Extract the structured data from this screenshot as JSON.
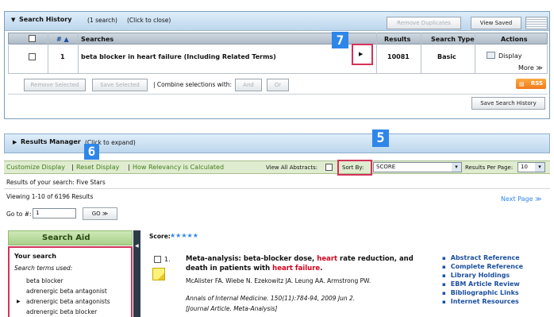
{
  "history": {
    "title": "Search History",
    "count": "(1 search)",
    "toggle": "(Click to close)",
    "remove_duplicates": "Remove Duplicates",
    "view_saved": "View Saved",
    "columns": {
      "num": "# ▲",
      "searches": "Searches",
      "results": "Results",
      "type": "Search Type",
      "actions": "Actions"
    },
    "row": {
      "num": "1",
      "search": "beta blocker in heart failure (Including Related Terms)",
      "results": "10081",
      "type": "Basic",
      "display": "Display",
      "more": "More ≫"
    },
    "remove_selected": "Remove Selected",
    "save_selected": "Save Selected",
    "combine_label": "| Combine selections with:",
    "and": "And",
    "or": "Or",
    "rss": "RSS",
    "save_history": "Save Search History"
  },
  "results_manager": {
    "title": "Results Manager",
    "hint": "(Click to expand)"
  },
  "toolbar": {
    "customize": "Customize Display",
    "reset": "Reset Display",
    "relevancy": "How Relevancy is Calculated",
    "view_abstracts": "View All Abstracts:",
    "sort_by": "Sort By:",
    "sort_value": "SCORE",
    "per_page_label": "Results Per Page:",
    "per_page_value": "10"
  },
  "results": {
    "search_label": "Results of your search: Five Stars",
    "viewing": "Viewing 1-10 of 6196 Results",
    "goto_label": "Go to #:",
    "goto_value": "1",
    "go_button": "GO ≫",
    "next_page": "Next Page ≫"
  },
  "search_aid": {
    "title": "Search Aid",
    "your_search": "Your search",
    "terms_used": "Search terms used:",
    "terms": [
      "beta blocker",
      "adrenergic beta antagonist",
      "adrenergic beta antagonists",
      "adrenergic beta blocker"
    ]
  },
  "record": {
    "score_label": "Score:",
    "stars": "★★★★★",
    "number": "1.",
    "title_a": "Meta-analysis: beta-blocker dose,",
    "title_hl1": "heart",
    "title_b": "rate reduction, and death in patients with",
    "title_hl2": "heart failure",
    "title_end": ".",
    "authors": "McAlister FA. Wiebe N. Ezekowitz JA. Leung AA. Armstrong PW.",
    "citation": "Annals of Internal Medicine. 150(11):784-94, 2009 Jun 2.",
    "pubtype": "[Journal Article. Meta-Analysis]",
    "links": [
      "Abstract Reference",
      "Complete Reference",
      "Library Holdings",
      "EBM Article Review",
      "Bibliographic Links",
      "Internet Resources"
    ]
  },
  "markers": {
    "seven": "7",
    "five": "5",
    "six": "6"
  },
  "colors": {
    "accent": "#2f86e9",
    "highlight_box": "#d4325a",
    "heart_text": "#d6001c",
    "toolbar_green": "#dfeccf"
  }
}
